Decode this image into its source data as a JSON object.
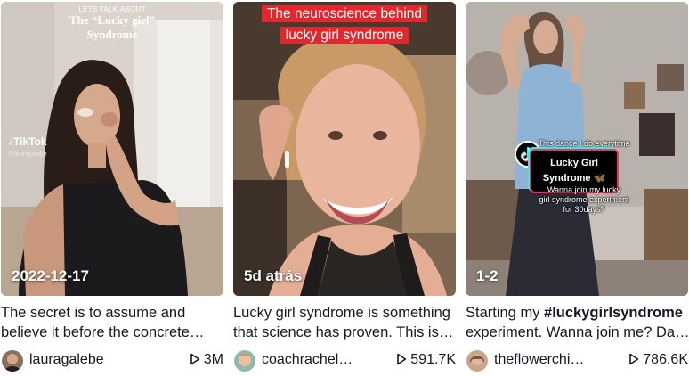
{
  "cards": [
    {
      "overlay_small": "LETS TALK ABOUT",
      "overlay_title_1": "The “Lucky girl”",
      "overlay_title_2": "Syndrome",
      "watermark": "TikTok",
      "watermark_handle": "@lauragalebe",
      "date": "2022-12-17",
      "caption_line1": "The secret is to assume and",
      "caption_line2": "believe it before the concrete…",
      "author": "lauragalebe",
      "views": "3M"
    },
    {
      "overlay_title_1": "The neuroscience behind",
      "overlay_title_2": "lucky girl syndrome",
      "date": "5d atrás",
      "caption_line1": "Lucky girl syndrome is something",
      "caption_line2": "that science has proven. This is…",
      "author": "coachrachel…",
      "views": "591.7K"
    },
    {
      "overlay_top": "This dance I do everytime",
      "sticker_line1": "Lucky Girl",
      "sticker_line2": "Syndrome 🦋",
      "overlay_bottom_1": "Wanna join my lucky",
      "overlay_bottom_2": "girl syndrome experiment",
      "overlay_bottom_3": "for 30days?",
      "date": "1-2",
      "caption_prefix": "Starting my ",
      "caption_hashtag": "#luckygirlsyndrome",
      "caption_line2": "experiment. Wanna join me? Da…",
      "author": "theflowerchi…",
      "views": "786.6K"
    }
  ],
  "colors": {
    "text": "#161823",
    "red_label": "#e0282e",
    "tiktok_cyan": "#25f4ee",
    "tiktok_pink": "#ff2b5e"
  },
  "icons": {
    "views": "play-icon"
  }
}
